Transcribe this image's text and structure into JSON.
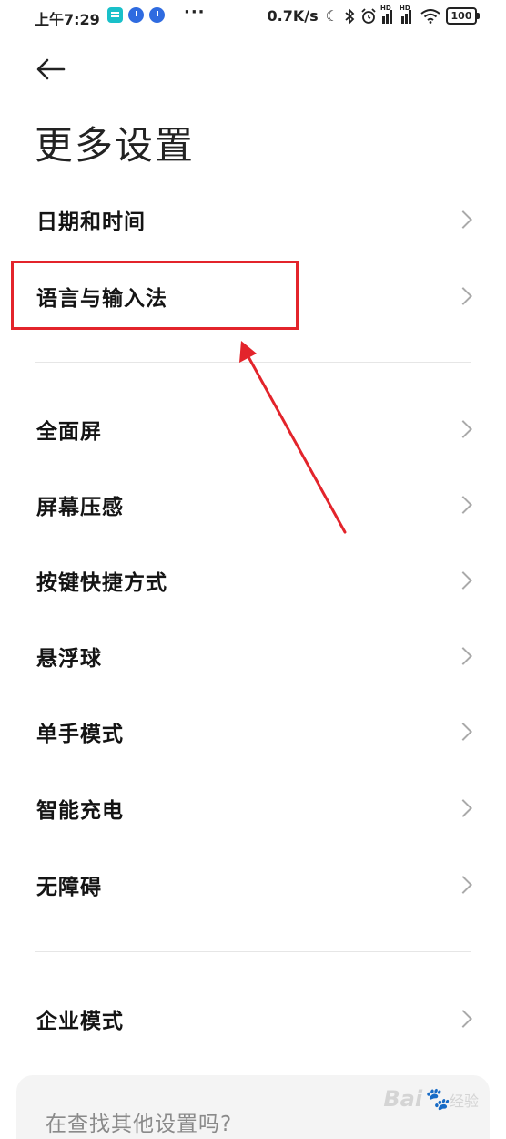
{
  "status_bar": {
    "time": "上午7:29",
    "more": "···",
    "net_speed": "0.7K/s",
    "battery": "100",
    "sig_label": "HD",
    "icons": [
      "message-app-icon",
      "clock-app-icon",
      "clock-app-icon",
      "moon-icon",
      "bluetooth-icon",
      "alarm-icon",
      "signal-icon",
      "signal-icon",
      "wifi-icon",
      "battery-icon"
    ]
  },
  "header": {
    "title": "更多设置"
  },
  "section1": [
    {
      "label": "日期和时间"
    },
    {
      "label": "语言与输入法"
    }
  ],
  "section2": [
    {
      "label": "全面屏"
    },
    {
      "label": "屏幕压感"
    },
    {
      "label": "按键快捷方式"
    },
    {
      "label": "悬浮球"
    },
    {
      "label": "单手模式"
    },
    {
      "label": "智能充电"
    },
    {
      "label": "无障碍"
    }
  ],
  "section3": [
    {
      "label": "企业模式"
    }
  ],
  "search_card": {
    "prompt": "在查找其他设置吗?"
  },
  "annotation_color": "#e3242b",
  "watermark": {
    "brand": "Bai",
    "suffix": "经验"
  }
}
